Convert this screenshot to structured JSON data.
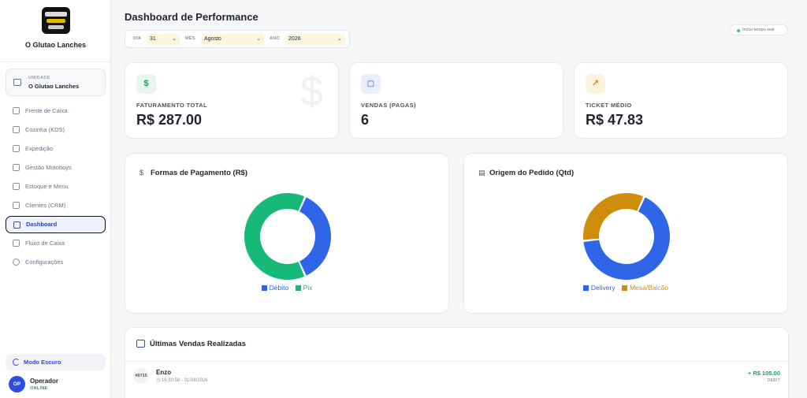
{
  "brand": {
    "name": "O Glutao Lanches"
  },
  "unit": {
    "label": "UNIDADE",
    "value": "O Glutao Lanches"
  },
  "nav": [
    {
      "label": "Frente de Caixa",
      "icon": "cart-icon"
    },
    {
      "label": "Cozinha (KDS)",
      "icon": "chef-hat-icon"
    },
    {
      "label": "Expedição",
      "icon": "truck-icon"
    },
    {
      "label": "Gestão Motoboys",
      "icon": "bike-icon"
    },
    {
      "label": "Estoque e Menu",
      "icon": "box-icon"
    },
    {
      "label": "Clientes (CRM)",
      "icon": "users-icon"
    },
    {
      "label": "Dashboard",
      "icon": "grid-icon",
      "active": true
    },
    {
      "label": "Fluxo de Caixa",
      "icon": "dollar-icon"
    },
    {
      "label": "Configurações",
      "icon": "gear-icon"
    }
  ],
  "dark_mode": {
    "label": "Modo Escuro"
  },
  "operator": {
    "initials": "OP",
    "name": "Operador",
    "status": "ONLINE"
  },
  "header": {
    "title": "Dashboard de Performance",
    "filters": {
      "day_label": "DIA",
      "day_value": "31",
      "month_label": "MÊS",
      "month_value": "Agosto",
      "year_label": "ANO",
      "year_value": "2026"
    },
    "realtime_label": "Inclui tempo real"
  },
  "kpis": [
    {
      "label": "FATURAMENTO TOTAL",
      "value": "R$ 287.00",
      "icon": "dollar-icon",
      "watermark": "$"
    },
    {
      "label": "VENDAS (PAGAS)",
      "value": "6",
      "icon": "shopping-bag-icon"
    },
    {
      "label": "TICKET MÉDIO",
      "value": "R$ 47.83",
      "icon": "trending-up-icon"
    }
  ],
  "colors": {
    "accent": "#2b4de0",
    "green": "#18a463",
    "pix": "#17b979",
    "debit": "#2f66e8",
    "mesa": "#cf8d0b"
  },
  "chart_data": [
    {
      "type": "pie",
      "title": "Formas de Pagamento (R$)",
      "categories": [
        "Débito",
        "Pix"
      ],
      "values": [
        105,
        182
      ],
      "colors": [
        "#2f66e8",
        "#17b979"
      ],
      "legend": "bottom"
    },
    {
      "type": "pie",
      "title": "Origem do Pedido (Qtd)",
      "categories": [
        "Delivery",
        "Mesa/Balcão"
      ],
      "values": [
        4,
        2
      ],
      "colors": [
        "#2f66e8",
        "#cf8d0b"
      ],
      "legend": "bottom"
    }
  ],
  "sales": {
    "title": "Últimas Vendas Realizadas",
    "rows": [
      {
        "id": "#9715",
        "customer": "Enzo",
        "datetime": "16:30:58 - 31/08/2026",
        "amount": "+ R$ 105.00",
        "method": "DEBIT"
      }
    ]
  }
}
